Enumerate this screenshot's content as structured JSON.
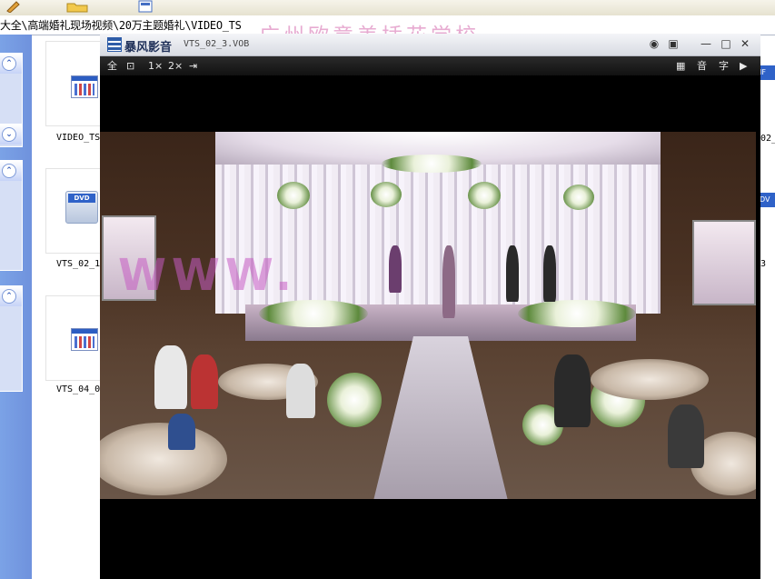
{
  "explorer": {
    "address_path": "大全\\高端婚礼现场视频\\20万主题婚礼\\VIDEO_TS",
    "watermark_text": "广州欧意美插花学校",
    "files": [
      {
        "label": "VIDEO_TS",
        "icon": "ifo-file-icon"
      },
      {
        "label": "VTS_02_1",
        "icon": "dvd-vob-icon"
      },
      {
        "label": "VTS_04_0",
        "icon": "ifo-file-icon"
      }
    ],
    "right_column_labels": [
      "02_",
      "3"
    ],
    "right_column_badges": [
      "IF",
      "DV"
    ],
    "collapse_symbols": [
      "⌃",
      "⌄",
      "⌃",
      "⌃"
    ]
  },
  "player": {
    "app_name": "暴风影音",
    "file_title": "VTS_02_3.VOB",
    "title_buttons": {
      "help": "◉",
      "settings": "▣",
      "minimize": "—",
      "maximize": "□",
      "close": "✕"
    },
    "controls_left": [
      "全",
      "⊡",
      "1×",
      "2×",
      "⇥"
    ],
    "controls_right": [
      "▦",
      "音",
      "字",
      "▶"
    ]
  },
  "colors": {
    "task_pane": "#7ba2e6",
    "player_black": "#000000",
    "watermark_pink": "#e6a7cf"
  }
}
